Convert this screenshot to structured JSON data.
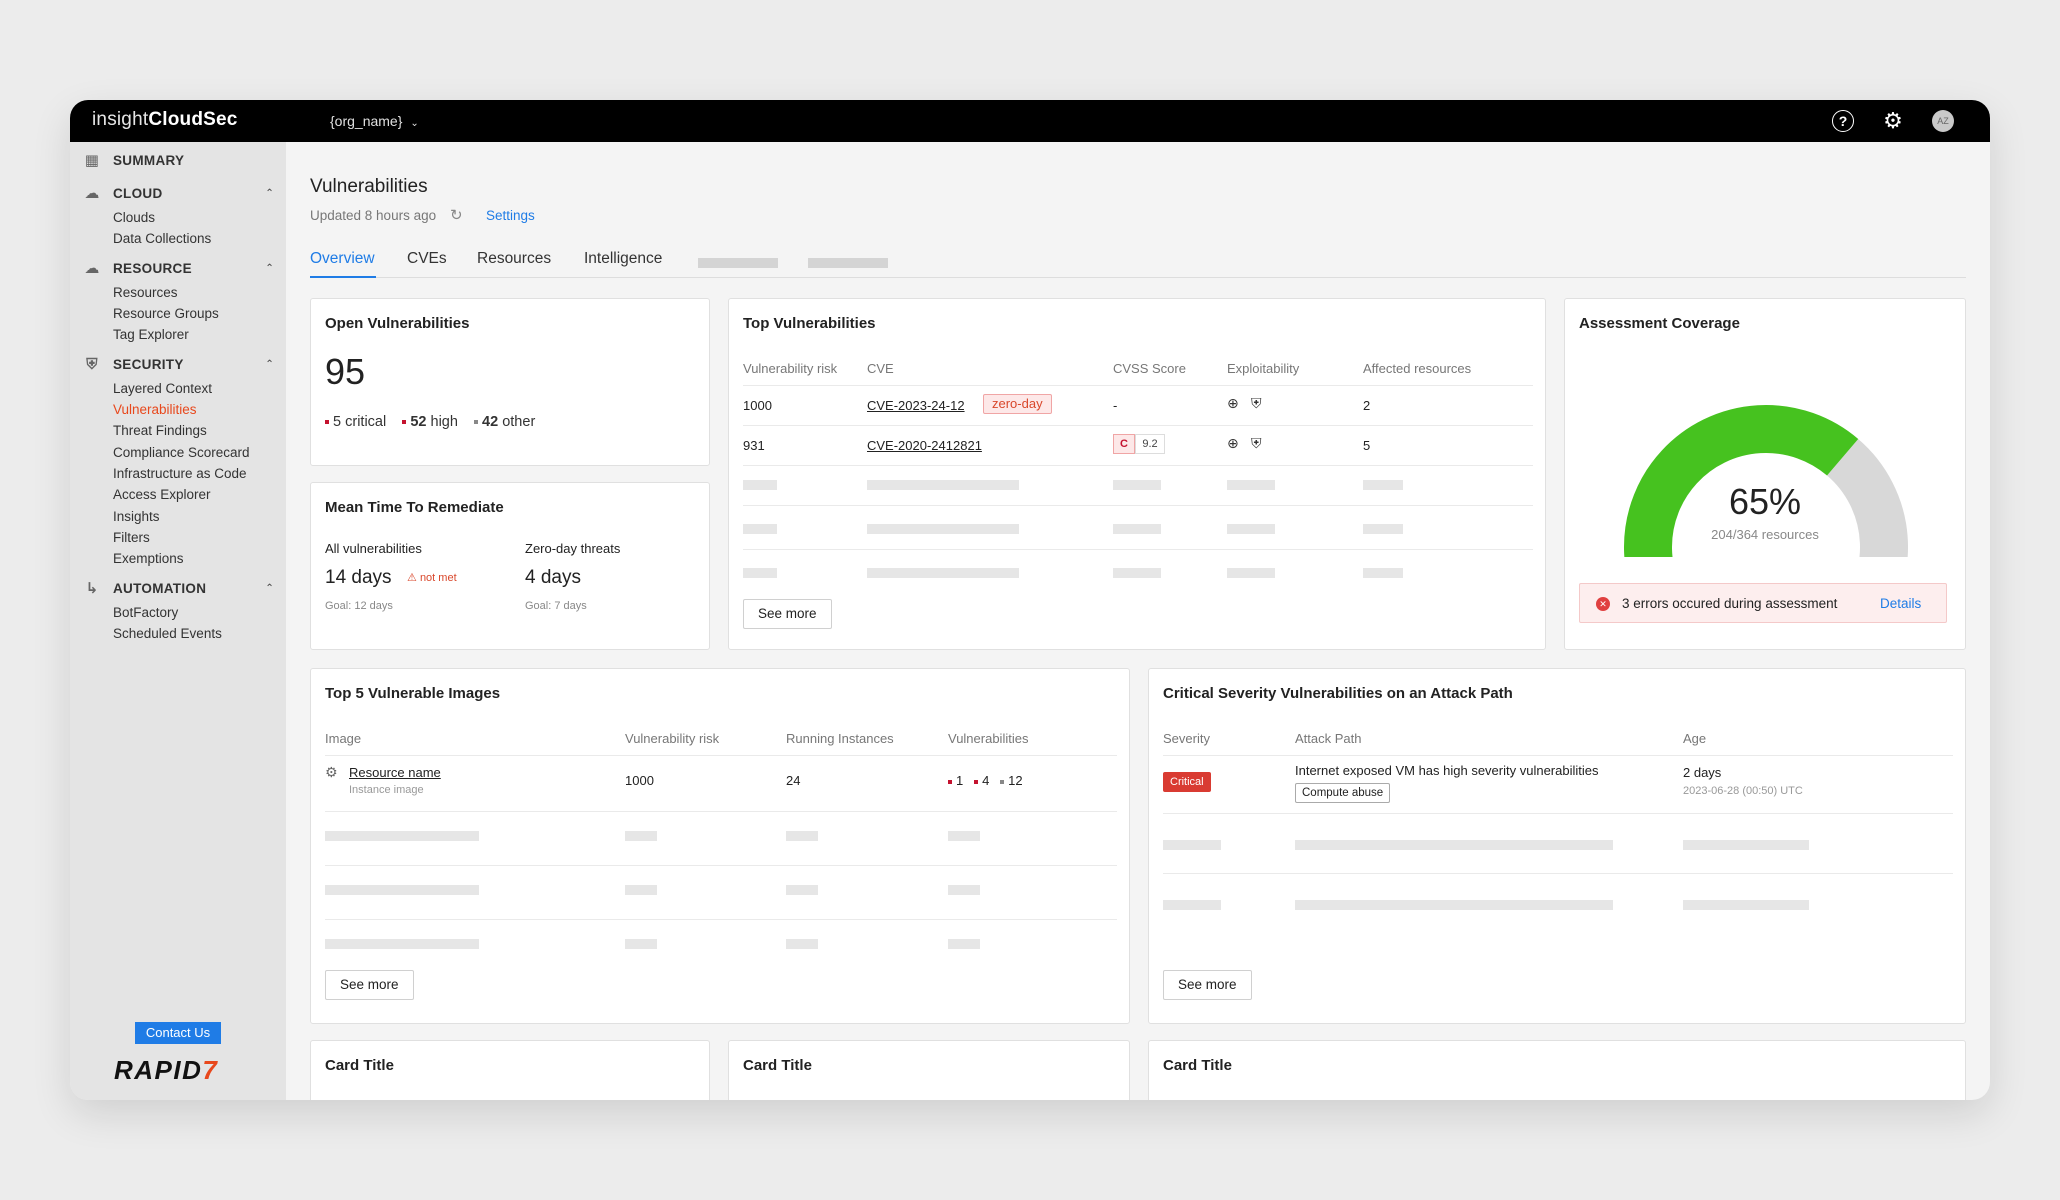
{
  "app": {
    "brand_light": "insight",
    "brand_bold": "CloudSec",
    "org": "{org_name}",
    "avatar_initials": "AZ"
  },
  "sidebar": {
    "sections": [
      {
        "label": "SUMMARY",
        "icon": "grid-icon",
        "items": []
      },
      {
        "label": "CLOUD",
        "icon": "cloud-icon",
        "items": [
          "Clouds",
          "Data Collections"
        ]
      },
      {
        "label": "RESOURCE",
        "icon": "cloud-icon",
        "items": [
          "Resources",
          "Resource Groups",
          "Tag Explorer"
        ]
      },
      {
        "label": "SECURITY",
        "icon": "shield-icon",
        "items": [
          "Layered Context",
          "Vulnerabilities",
          "Threat Findings",
          "Compliance Scorecard",
          "Infrastructure as Code",
          "Access Explorer",
          "Insights",
          "Filters",
          "Exemptions"
        ]
      },
      {
        "label": "AUTOMATION",
        "icon": "flow-icon",
        "items": [
          "BotFactory",
          "Scheduled Events"
        ]
      }
    ],
    "contact": "Contact Us",
    "logo_text": "RAPID",
    "logo_mark": "7"
  },
  "page": {
    "title": "Vulnerabilities",
    "updated": "Updated 8 hours ago",
    "settings": "Settings"
  },
  "tabs": [
    "Overview",
    "CVEs",
    "Resources",
    "Intelligence"
  ],
  "open_vulns": {
    "title": "Open Vulnerabilities",
    "total": "95",
    "critical": "5",
    "critical_label": "critical",
    "high": "52",
    "high_label": "high",
    "other": "42",
    "other_label": "other"
  },
  "mttr": {
    "title": "Mean Time To Remediate",
    "all_label": "All vulnerabilities",
    "all_value": "14 days",
    "all_status": "not met",
    "all_goal": "Goal: 12 days",
    "zd_label": "Zero-day threats",
    "zd_value": "4 days",
    "zd_goal": "Goal: 7 days"
  },
  "top_vulns": {
    "title": "Top Vulnerabilities",
    "headers": [
      "Vulnerability risk",
      "CVE",
      "CVSS Score",
      "Exploitability",
      "Affected resources"
    ],
    "rows": [
      {
        "risk": "1000",
        "cve": "CVE-2023-24-12",
        "badge": "zero-day",
        "cvss": "-",
        "affected": "2"
      },
      {
        "risk": "931",
        "cve": "CVE-2020-2412821",
        "cvss_letter": "C",
        "cvss": "9.2",
        "affected": "5"
      }
    ],
    "see_more": "See more"
  },
  "coverage": {
    "title": "Assessment Coverage",
    "percent_label": "65%",
    "percent_value": 0.65,
    "resources": "204/364 resources",
    "error_text": "3 errors occured during assessment",
    "details": "Details",
    "colors": {
      "filled": "#46c21f",
      "empty": "#d8d8d8"
    }
  },
  "images": {
    "title": "Top 5 Vulnerable Images",
    "headers": [
      "Image",
      "Vulnerability risk",
      "Running Instances",
      "Vulnerabilities"
    ],
    "row": {
      "name": "Resource name",
      "type": "Instance image",
      "risk": "1000",
      "instances": "24",
      "v_crit": "1",
      "v_high": "4",
      "v_other": "12"
    },
    "see_more": "See more"
  },
  "attack_path": {
    "title": "Critical Severity Vulnerabilities on an Attack Path",
    "headers": [
      "Severity",
      "Attack Path",
      "Age"
    ],
    "row": {
      "severity": "Critical",
      "path": "Internet exposed VM has high severity vulnerabilities",
      "tag": "Compute abuse",
      "age": "2 days",
      "date": "2023-06-28 (00:50) UTC"
    },
    "see_more": "See more"
  },
  "bottom_cards": [
    "Card Title",
    "Card Title",
    "Card Title"
  ]
}
